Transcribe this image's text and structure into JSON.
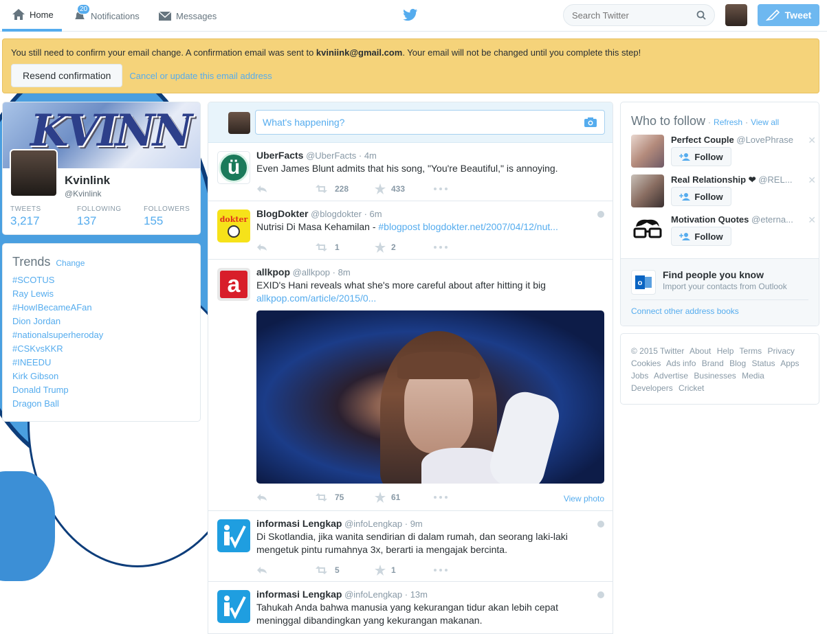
{
  "nav": {
    "home": "Home",
    "notifications": "Notifications",
    "notif_count": "20",
    "messages": "Messages",
    "search_placeholder": "Search Twitter",
    "tweet_button": "Tweet"
  },
  "alert": {
    "text_before": "You still need to confirm your email change. A confirmation email was sent to ",
    "email": "kviniink@gmail.com",
    "text_after": ". Your email will not be changed until you complete this step!",
    "resend": "Resend confirmation",
    "cancel": "Cancel or update this email address"
  },
  "profile": {
    "banner_text": "KVINN",
    "name": "Kvinlink",
    "handle": "@Kvinlink",
    "tweets_label": "TWEETS",
    "tweets": "3,217",
    "following_label": "FOLLOWING",
    "following": "137",
    "followers_label": "FOLLOWERS",
    "followers": "155"
  },
  "trends": {
    "title": "Trends",
    "change": "Change",
    "items": [
      "#SCOTUS",
      "Ray Lewis",
      "#HowIBecameAFan",
      "Dion Jordan",
      "#nationalsuperheroday",
      "#CSKvsKKR",
      "#INEEDU",
      "Kirk Gibson",
      "Donald Trump",
      "Dragon Ball"
    ]
  },
  "composer": {
    "placeholder": "What's happening?"
  },
  "tweets": [
    {
      "name": "UberFacts",
      "handle": "@UberFacts",
      "time": "4m",
      "text": "Even James Blunt admits that his song, \"You're Beautiful,\" is annoying.",
      "retweets": "228",
      "favorites": "433",
      "avatar_text": "ü"
    },
    {
      "name": "BlogDokter",
      "handle": "@blogdokter",
      "time": "6m",
      "text": "Nutrisi Di Masa Kehamilan - ",
      "link": "#blogpost blogdokter.net/2007/04/12/nut...",
      "retweets": "1",
      "favorites": "2",
      "avatar_text": "dokter"
    },
    {
      "name": "allkpop",
      "handle": "@allkpop",
      "time": "8m",
      "text": "EXID's Hani reveals what she's more careful about after hitting it big",
      "link": "allkpop.com/article/2015/0...",
      "retweets": "75",
      "favorites": "61",
      "avatar_text": "a",
      "view_photo": "View photo"
    },
    {
      "name": "informasi Lengkap",
      "handle": "@infoLengkap",
      "time": "9m",
      "text": "Di Skotlandia, jika wanita sendirian di dalam rumah, dan seorang laki-laki mengetuk pintu rumahnya 3x, berarti ia mengajak bercinta.",
      "retweets": "5",
      "favorites": "1"
    },
    {
      "name": "informasi Lengkap",
      "handle": "@infoLengkap",
      "time": "13m",
      "text": "Tahukah Anda bahwa manusia yang kekurangan tidur akan lebih cepat meninggal dibandingkan yang kekurangan makanan."
    }
  ],
  "who_to_follow": {
    "title": "Who to follow",
    "refresh": "Refresh",
    "view_all": "View all",
    "follow_label": "Follow",
    "suggestions": [
      {
        "name": "Perfect Couple",
        "handle": "@LovePhrase"
      },
      {
        "name": "Real Relationship ❤",
        "handle": "@REL..."
      },
      {
        "name": "Motivation Quotes",
        "handle": "@eterna..."
      }
    ],
    "find_title": "Find people you know",
    "find_sub": "Import your contacts from Outlook",
    "connect": "Connect other address books"
  },
  "footer": [
    "© 2015 Twitter",
    "About",
    "Help",
    "Terms",
    "Privacy",
    "Cookies",
    "Ads info",
    "Brand",
    "Blog",
    "Status",
    "Apps",
    "Jobs",
    "Advertise",
    "Businesses",
    "Media",
    "Developers",
    "Cricket"
  ],
  "colors": {
    "accent": "#55acee",
    "alert_bg": "#f5d37a",
    "text": "#292f33",
    "muted": "#8899a6"
  }
}
